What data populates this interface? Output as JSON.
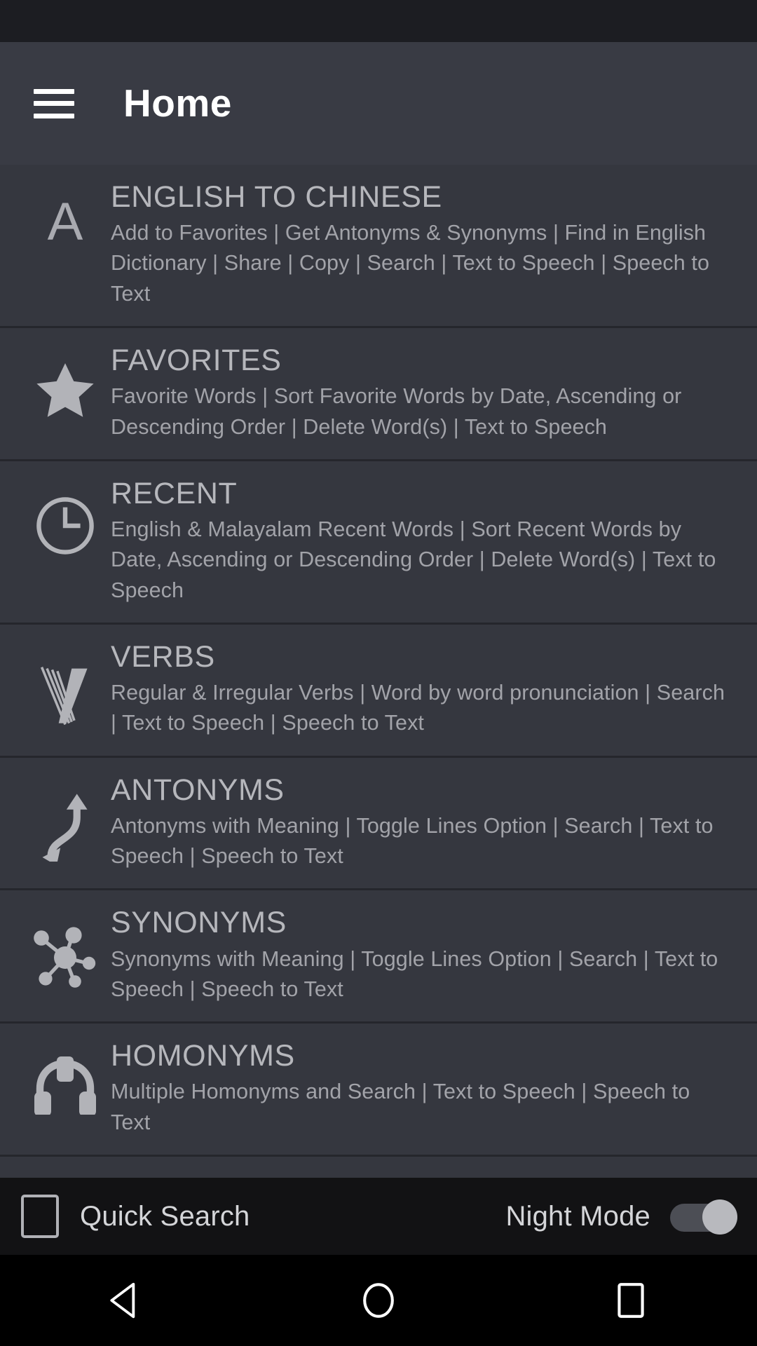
{
  "statusbar": {
    "present": true
  },
  "appbar": {
    "menu_icon": "hamburger-menu-icon",
    "title": "Home"
  },
  "theme": {
    "background": "#35373f",
    "appbar_bg": "#393b44",
    "bottombar_bg": "#121214",
    "navbar_bg": "#000000",
    "title_color": "#b6b7bc",
    "desc_color": "#a2a3a9",
    "icon_color": "#b2b3b8",
    "divider": "#25262c"
  },
  "list": {
    "items": [
      {
        "icon": "letter-a-icon",
        "title": "ENGLISH TO CHINESE",
        "desc": "Add to Favorites | Get Antonyms & Synonyms | Find in English Dictionary | Share | Copy | Search | Text to Speech | Speech to Text"
      },
      {
        "icon": "star-icon",
        "title": "FAVORITES",
        "desc": "Favorite Words | Sort Favorite Words by Date, Ascending or Descending Order | Delete Word(s) | Text to Speech"
      },
      {
        "icon": "clock-icon",
        "title": "RECENT",
        "desc": "English & Malayalam Recent Words | Sort Recent Words by Date, Ascending or Descending Order | Delete Word(s) | Text to Speech"
      },
      {
        "icon": "verb-v-icon",
        "title": "VERBS",
        "desc": "Regular & Irregular Verbs | Word by word pronunciation | Search | Text to Speech | Speech to Text"
      },
      {
        "icon": "opposite-arrows-icon",
        "title": "ANTONYMS",
        "desc": "Antonyms with Meaning | Toggle Lines Option | Search | Text to Speech | Speech to Text"
      },
      {
        "icon": "molecule-network-icon",
        "title": "SYNONYMS",
        "desc": "Synonyms with Meaning | Toggle Lines Option | Search | Text to Speech | Speech to Text"
      },
      {
        "icon": "headphones-icon",
        "title": "HOMONYMS",
        "desc": "Multiple Homonyms and Search | Text to Speech | Speech to Text"
      }
    ]
  },
  "bottombar": {
    "quick_search_label": "Quick Search",
    "quick_search_checked": false,
    "night_mode_label": "Night Mode",
    "night_mode_checked": true
  },
  "navbar": {
    "back_icon": "triangle-back-icon",
    "home_icon": "circle-home-icon",
    "recents_icon": "square-recents-icon"
  }
}
